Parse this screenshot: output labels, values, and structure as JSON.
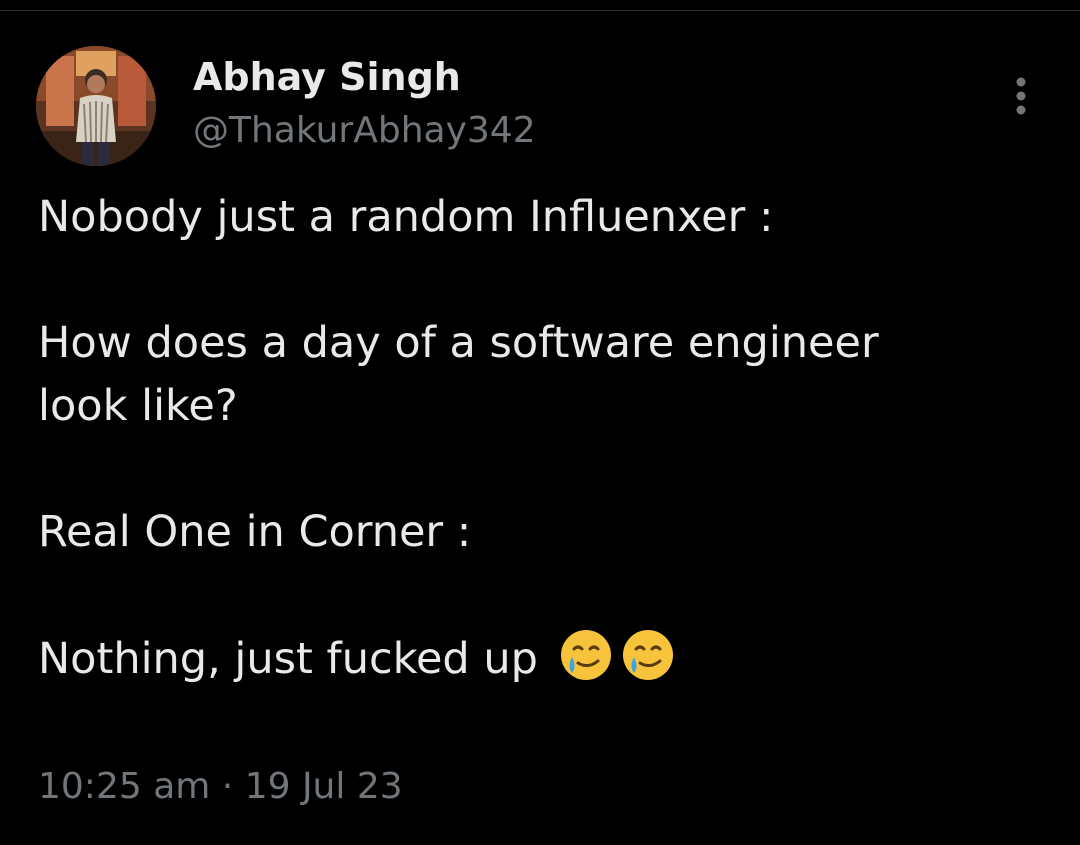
{
  "tweet": {
    "author": {
      "display_name": "Abhay Singh",
      "handle": "@ThakurAbhay342"
    },
    "text_lines": [
      "Nobody just a random Influenxer :",
      "How does a day of a software engineer",
      "look like?",
      "Real One in Corner :",
      "Nothing, just fucked up"
    ],
    "emojis": [
      "smiling-face-with-tear",
      "smiling-face-with-tear"
    ],
    "time": "10:25 am",
    "separator": "·",
    "date": "19 Jul 23"
  },
  "icons": {
    "more": "more-options-vertical-icon"
  },
  "colors": {
    "background": "#000000",
    "primary_text": "#e7e9ea",
    "secondary_text": "#71767b"
  }
}
